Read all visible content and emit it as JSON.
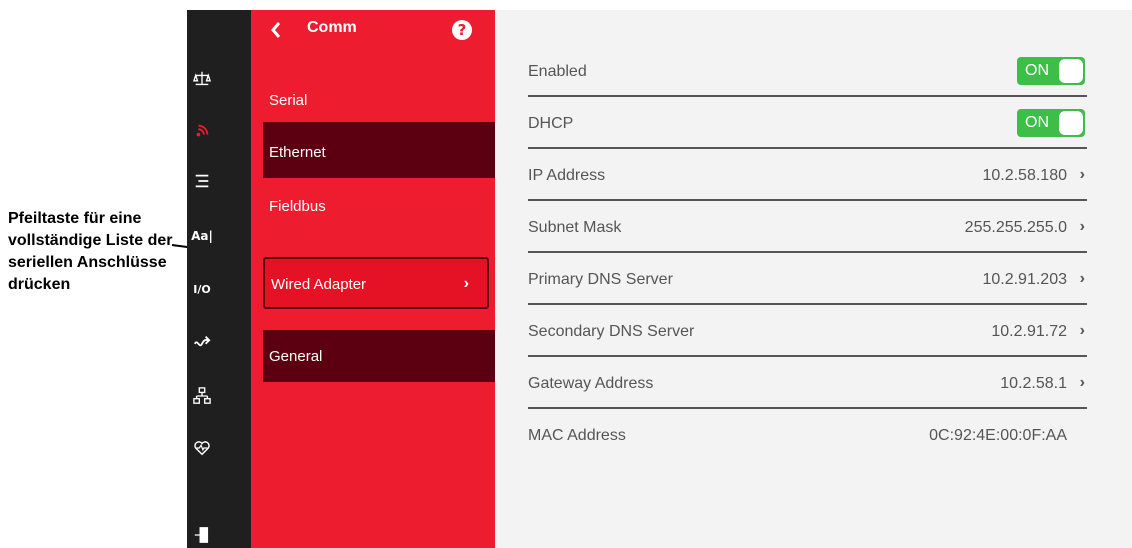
{
  "callout": {
    "text": "Pfeiltaste für eine vollständige Liste der seriellen Anschlüsse drücken"
  },
  "rail": {
    "icons": [
      {
        "name": "scale-icon"
      },
      {
        "name": "wireless-signal-icon",
        "color": "#ed1c2e",
        "active": true
      },
      {
        "name": "list-icon"
      },
      {
        "name": "font-icon",
        "text": "Aa|"
      },
      {
        "name": "io-icon",
        "text": "I/O"
      },
      {
        "name": "signal-routing-icon"
      },
      {
        "name": "network-tree-icon"
      },
      {
        "name": "health-heart-icon"
      },
      {
        "name": "logout-icon"
      }
    ]
  },
  "submenu": {
    "title": "Comm",
    "back_icon": "chevron-left-icon",
    "help_icon": "help-icon",
    "help_glyph": "?",
    "items": [
      {
        "label": "Serial"
      },
      {
        "label": "Ethernet",
        "selected": true
      },
      {
        "label": "Fieldbus"
      },
      {
        "label": "Wired Adapter",
        "chevron": "›"
      },
      {
        "label": "General",
        "selected": true
      }
    ]
  },
  "settings": {
    "rows": [
      {
        "label": "Enabled",
        "toggle": "ON"
      },
      {
        "label": "DHCP",
        "toggle": "ON"
      },
      {
        "label": "IP Address",
        "value": "10.2.58.180",
        "chevron": "›"
      },
      {
        "label": "Subnet Mask",
        "value": "255.255.255.0",
        "chevron": "›"
      },
      {
        "label": "Primary DNS Server",
        "value": "10.2.91.203",
        "chevron": "›"
      },
      {
        "label": "Secondary DNS Server",
        "value": "10.2.91.72",
        "chevron": "›"
      },
      {
        "label": "Gateway Address",
        "value": "10.2.58.1",
        "chevron": "›"
      },
      {
        "label": "MAC Address",
        "value": "0C:92:4E:00:0F:AA"
      }
    ]
  },
  "colors": {
    "accent_red": "#ed1c2e",
    "selected_dark": "#5c0011",
    "toggle_green": "#3fbd49",
    "rail_bg": "#1f1f1f",
    "content_bg": "#f4f3f3"
  }
}
